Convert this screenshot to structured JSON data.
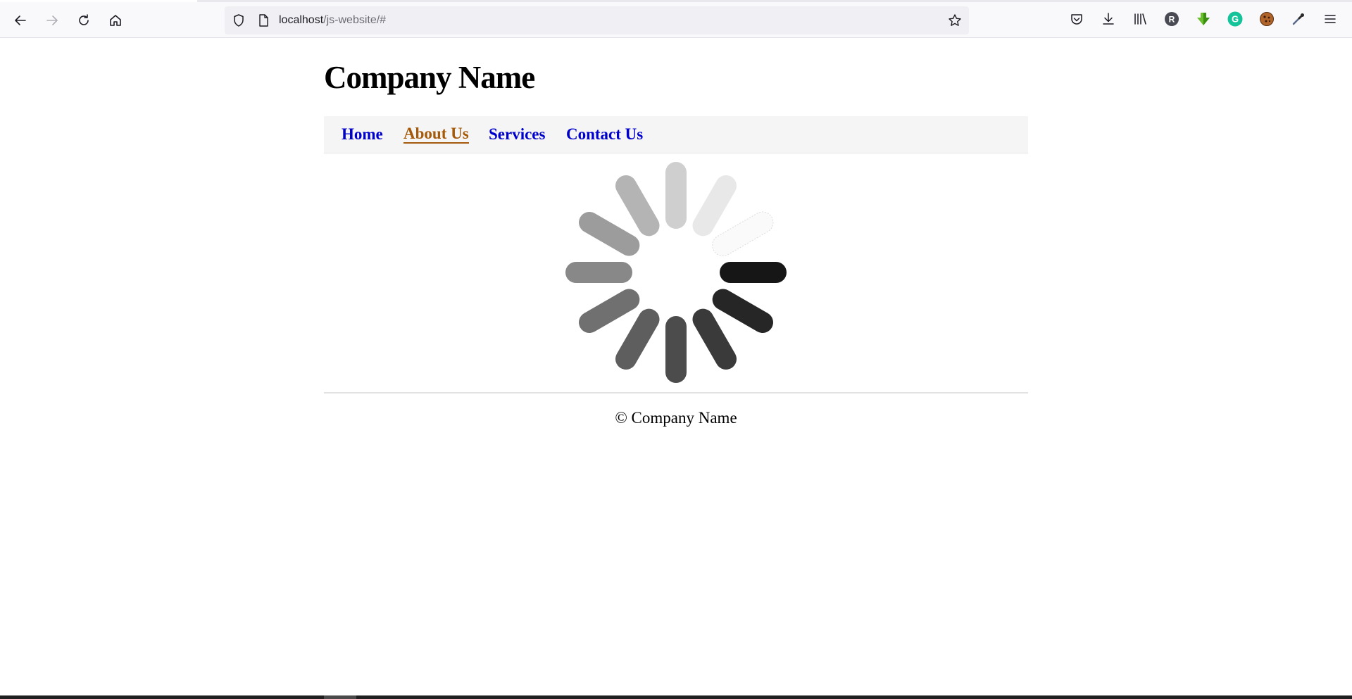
{
  "browser": {
    "url_host": "localhost",
    "url_path": "/js-website/#",
    "toolbar_icons": [
      "pocket-icon",
      "downloads-icon",
      "library-icon",
      "profile-icon",
      "green-arrow-extension-icon",
      "grammarly-icon",
      "cookie-extension-icon",
      "eyedropper-icon",
      "menu-icon"
    ],
    "profile_letter": "R",
    "grammarly_letter": "G"
  },
  "site": {
    "title": "Company Name",
    "nav": [
      {
        "label": "Home",
        "active": false
      },
      {
        "label": "About Us",
        "active": true
      },
      {
        "label": "Services",
        "active": false
      },
      {
        "label": "Contact Us",
        "active": false
      }
    ],
    "footer": "© Company Name"
  },
  "colors": {
    "link": "#0000cc",
    "link_active": "#a45a0a",
    "nav_background": "#f5f5f5",
    "grammarly": "#15c39a",
    "profile": "#4a4a55"
  },
  "spinner": {
    "icon": "loading-spinner-icon",
    "spoke_count": 12
  }
}
